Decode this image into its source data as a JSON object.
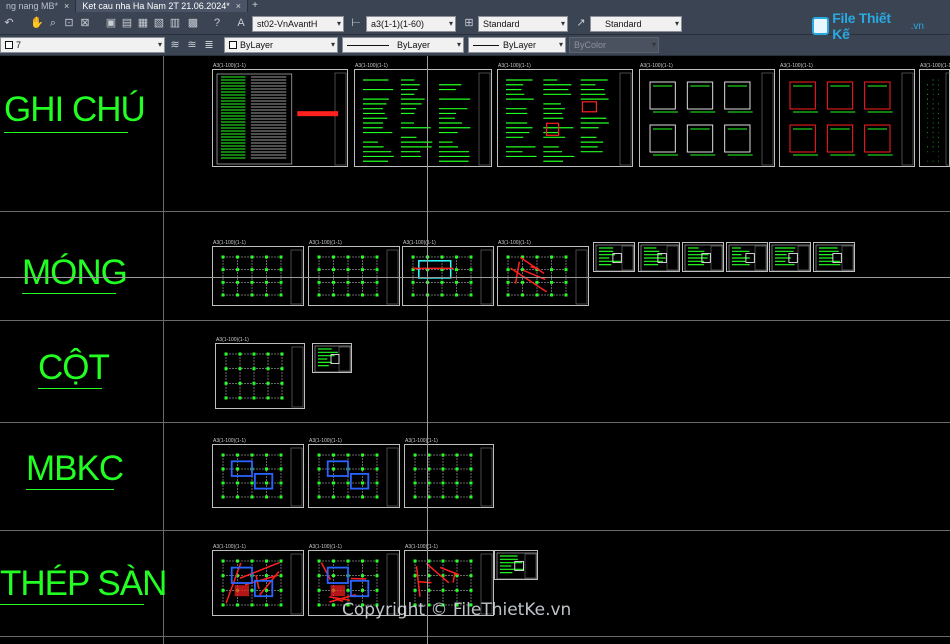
{
  "tabs": [
    {
      "label": "ng nang MB*",
      "active": false
    },
    {
      "label": "Ket cau nha Ha Nam 2T 21.06.2024*",
      "active": true
    }
  ],
  "toolbar": {
    "text_style": "st02-VnAvantH",
    "dim_style": "a3(1-1)(1-60)",
    "table_style": "Standard",
    "multileader_style": "Standard",
    "layer": "7",
    "color": "ByLayer",
    "linetype": "ByLayer",
    "lineweight": "ByLayer",
    "plot_style": "ByColor"
  },
  "watermark": {
    "logo_text": "File Thiết Kế",
    "logo_domain": ".vn"
  },
  "sections": [
    {
      "title": "GHI CHÚ"
    },
    {
      "title": "MÓNG"
    },
    {
      "title": "CỘT"
    },
    {
      "title": "MBKC"
    },
    {
      "title": "THÉP SÀN"
    }
  ],
  "sheet_label": "A3(1-100)(1-1)",
  "copyright": "Copyright © FileThietKe.vn",
  "colors": {
    "section_text": "#22ff22",
    "toolbar_bg": "#3b4453",
    "canvas_bg": "#000000",
    "sheet_green": "#22ff22",
    "sheet_red": "#ff2020",
    "sheet_blue": "#2a64ff",
    "sheet_cyan": "#33ffff"
  },
  "icons": [
    "pan-icon",
    "zoom-icon",
    "zoom-window-icon",
    "save-icon",
    "print-icon",
    "help-icon",
    "text-style-icon",
    "dim-style-icon",
    "table-style-icon",
    "mleader-style-icon",
    "layer-icon"
  ]
}
